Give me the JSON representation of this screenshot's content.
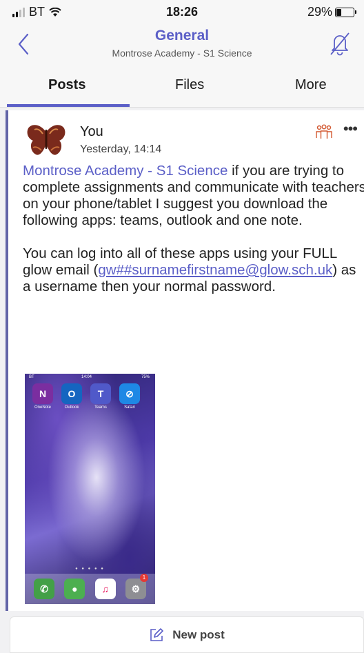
{
  "status_bar": {
    "carrier": "BT",
    "time": "18:26",
    "battery": "29%",
    "battery_level": 0.29
  },
  "header": {
    "title": "General",
    "subtitle": "Montrose Academy - S1 Science"
  },
  "tabs": [
    {
      "label": "Posts",
      "active": true
    },
    {
      "label": "Files"
    },
    {
      "label": "More"
    }
  ],
  "post": {
    "author": "You",
    "time": "Yesterday, 14:14",
    "mention": "Montrose Academy - S1 Science",
    "text1": " if you are trying to complete assignments and communicate with teachers on your phone/tablet I suggest you download the following apps: teams, outlook and one note.",
    "text2a": "You can log into all of these apps using your FULL glow email (",
    "email": "gw##surnamefirstname@glow.sch.uk",
    "text2b": ") as a username then your normal password."
  },
  "thumbnail": {
    "carrier": "BT",
    "time": "14:04",
    "battery": "75%",
    "apps": [
      {
        "label": "OneNote",
        "glyph": "N",
        "color": "#7b2ea0"
      },
      {
        "label": "Outlook",
        "glyph": "O",
        "color": "#1565c0"
      },
      {
        "label": "Teams",
        "glyph": "T",
        "color": "#5059c9"
      },
      {
        "label": "Safari",
        "glyph": "⊘",
        "color": "#1e88e5"
      }
    ],
    "dock": [
      {
        "name": "phone",
        "glyph": "✆",
        "color": "#43a047"
      },
      {
        "name": "messages",
        "glyph": "●",
        "color": "#4caf50"
      },
      {
        "name": "music",
        "glyph": "♫",
        "color": "#ffffff"
      },
      {
        "name": "settings",
        "glyph": "⚙",
        "color": "#8e8e93"
      }
    ],
    "settings_badge": "1"
  },
  "new_post": {
    "label": "New post"
  },
  "colors": {
    "accent": "#5b5fc7",
    "post_border": "#6264a7"
  }
}
